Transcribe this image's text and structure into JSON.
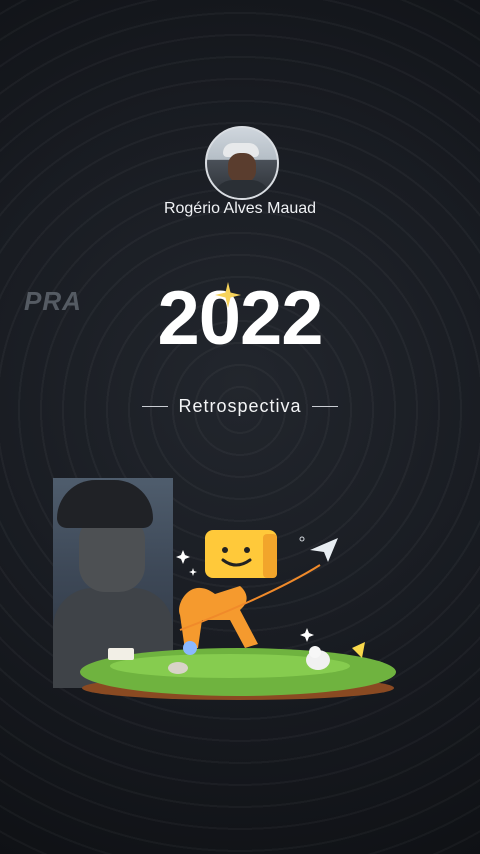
{
  "profile": {
    "name": "Rogério Alves Mauad",
    "avatar_icon": "user-avatar"
  },
  "header": {
    "side_text": "PRA",
    "year": "2022",
    "subtitle": "Retrospectiva"
  },
  "media": {
    "camera_feed": "front-camera-preview",
    "illustration": "mascot-on-grass-island"
  },
  "colors": {
    "background": "#15181d",
    "text": "#ffffff",
    "accent": "#f7c84a"
  }
}
